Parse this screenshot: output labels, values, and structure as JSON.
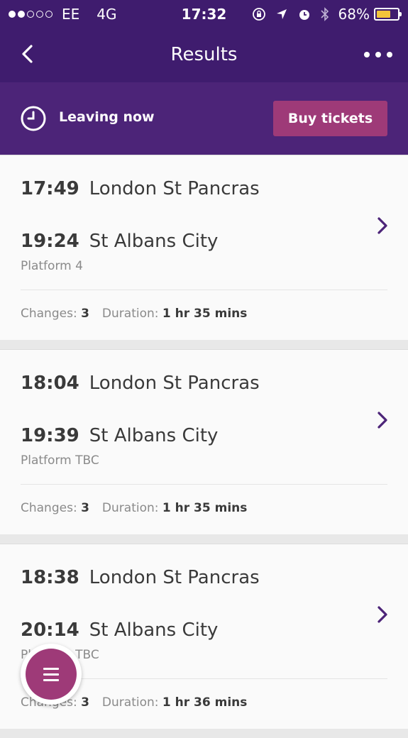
{
  "status_bar": {
    "carrier": "EE",
    "network": "4G",
    "time": "17:32",
    "battery": "68%",
    "battery_level": 0.68,
    "signal_bars": 2
  },
  "nav": {
    "title": "Results",
    "back_icon": "chevron-left-icon",
    "more_icon": "more-dots-icon"
  },
  "filter": {
    "leaving_label": "Leaving now",
    "buy_tickets_label": "Buy tickets"
  },
  "results": [
    {
      "dep_time": "17:49",
      "dep_station": "London St Pancras",
      "arr_time": "19:24",
      "arr_station": "St Albans City",
      "platform": "Platform 4",
      "changes_label": "Changes:",
      "changes": "3",
      "duration_label": "Duration:",
      "duration": "1 hr 35 mins"
    },
    {
      "dep_time": "18:04",
      "dep_station": "London St Pancras",
      "arr_time": "19:39",
      "arr_station": "St Albans City",
      "platform": "Platform TBC",
      "changes_label": "Changes:",
      "changes": "3",
      "duration_label": "Duration:",
      "duration": "1 hr 35 mins"
    },
    {
      "dep_time": "18:38",
      "dep_station": "London St Pancras",
      "arr_time": "20:14",
      "arr_station": "St Albans City",
      "platform": "Platform TBC",
      "changes_label": "Changes:",
      "changes": "3",
      "duration_label": "Duration:",
      "duration": "1 hr 36 mins"
    }
  ],
  "colors": {
    "header": "#3f1c6e",
    "filter_bar": "#4c2478",
    "accent": "#9e3a78",
    "chevron": "#4c2478"
  }
}
